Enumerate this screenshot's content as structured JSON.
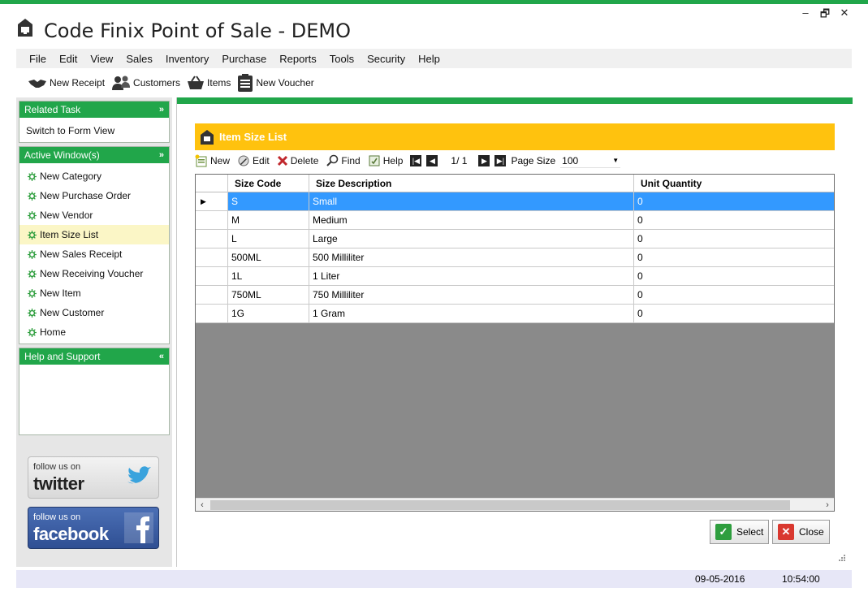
{
  "window": {
    "title": "Code Finix Point of Sale - DEMO",
    "minimize": "–",
    "restore": "🗗",
    "close": "✕"
  },
  "menu": [
    "File",
    "Edit",
    "View",
    "Sales",
    "Inventory",
    "Purchase",
    "Reports",
    "Tools",
    "Security",
    "Help"
  ],
  "toolbar": {
    "new_receipt": "New Receipt",
    "customers": "Customers",
    "items": "Items",
    "new_voucher": "New Voucher"
  },
  "sidebar": {
    "related_task": {
      "title": "Related Task",
      "items": [
        "Switch to Form View"
      ]
    },
    "active_windows": {
      "title": "Active Window(s)",
      "items": [
        "New Category",
        "New Purchase Order",
        "New Vendor",
        "Item Size List",
        "New Sales Receipt",
        "New Receiving Voucher",
        "New Item",
        "New Customer",
        "Home"
      ],
      "active_index": 3
    },
    "help": {
      "title": "Help and Support"
    },
    "twitter": {
      "small": "follow us on",
      "big": "twitter"
    },
    "facebook": {
      "small": "follow us on",
      "big": "facebook"
    }
  },
  "form": {
    "title": "Item Size List",
    "tools": {
      "new": "New",
      "edit": "Edit",
      "delete": "Delete",
      "find": "Find",
      "help": "Help",
      "page_info": "1/ 1",
      "page_size_label": "Page Size",
      "page_size_value": "100"
    },
    "columns": [
      "Size Code",
      "Size Description",
      "Unit Quantity"
    ],
    "rows": [
      {
        "code": "S",
        "desc": "Small",
        "qty": "0"
      },
      {
        "code": "M",
        "desc": "Medium",
        "qty": "0"
      },
      {
        "code": "L",
        "desc": "Large",
        "qty": "0"
      },
      {
        "code": "500ML",
        "desc": "500 Milliliter",
        "qty": "0"
      },
      {
        "code": "1L",
        "desc": "1 Liter",
        "qty": "0"
      },
      {
        "code": "750ML",
        "desc": "750 Milliliter",
        "qty": "0"
      },
      {
        "code": "1G",
        "desc": "1 Gram",
        "qty": "0"
      }
    ],
    "selected_row": 0,
    "select_button": "Select",
    "close_button": "Close"
  },
  "status": {
    "date": "09-05-2016",
    "time": "10:54:00"
  },
  "colors": {
    "accent_green": "#21a64a",
    "header_yellow": "#ffc20e",
    "selection_blue": "#3399ff"
  }
}
